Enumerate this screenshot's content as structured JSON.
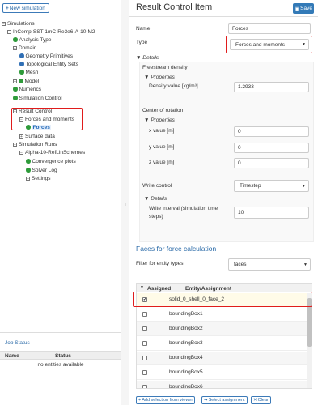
{
  "left": {
    "new_sim_label": "New simulation",
    "tree": [
      {
        "label": "Simulations"
      },
      {
        "label": "InComp-SST-1mC-Re3e6-A-10-M2"
      },
      {
        "label": "Analysis Type"
      },
      {
        "label": "Domain"
      },
      {
        "label": "Geometry Primitives"
      },
      {
        "label": "Topological Entity Sets"
      },
      {
        "label": "Mesh"
      },
      {
        "label": "Model"
      },
      {
        "label": "Numerics"
      },
      {
        "label": "Simulation Control"
      },
      {
        "label": "Result Control"
      },
      {
        "label": "Forces and moments"
      },
      {
        "label": "Forces"
      },
      {
        "label": "Surface data"
      },
      {
        "label": "Simulation Runs"
      },
      {
        "label": "Alpha-10-RefLinSchemes"
      },
      {
        "label": "Convergence plots"
      },
      {
        "label": "Solver Log"
      },
      {
        "label": "Settings"
      }
    ],
    "job": {
      "title": "Job Status",
      "col_name": "Name",
      "col_status": "Status",
      "empty": "no entities available"
    }
  },
  "right": {
    "title": "Result Control Item",
    "save_label": "Save",
    "name_label": "Name",
    "name_value": "Forces",
    "type_label": "Type",
    "type_value": "Forces and moments",
    "details_label": "Details",
    "freestream_label": "Freestream density",
    "properties_label": "Properties",
    "density_label": "Density value [kg/m³]",
    "density_value": "1.2933",
    "center_label": "Center of rotation",
    "properties2_label": "Properties",
    "x_label": "x value [m]",
    "x_value": "0",
    "y_label": "y value [m]",
    "y_value": "0",
    "z_label": "z value [m]",
    "z_value": "0",
    "write_label": "Write control",
    "write_value": "Timestep",
    "details2_label": "Details",
    "interval_label_1": "Write interval (simulation time",
    "interval_label_2": "steps)",
    "interval_value": "10",
    "faces_title": "Faces for force calculation",
    "filter_label": "Filter for entity types",
    "filter_value": "faces",
    "table": {
      "col_assigned": "Assigned",
      "col_entity": "Entity/Assignment",
      "rows": [
        {
          "name": "solid_0_shell_0_face_2",
          "checked": true
        },
        {
          "name": "boundingBox1",
          "checked": false
        },
        {
          "name": "boundingBox2",
          "checked": false
        },
        {
          "name": "boundingBox3",
          "checked": false
        },
        {
          "name": "boundingBox4",
          "checked": false
        },
        {
          "name": "boundingBox5",
          "checked": false
        },
        {
          "name": "boundingBox6",
          "checked": false
        }
      ]
    },
    "buttons": {
      "add": "Add selection from viewer",
      "select": "Select assignment",
      "clear": "Clear"
    }
  },
  "colors": {
    "accent": "#337ab7",
    "highlight": "#e01c1c",
    "ok": "#2e9b3a"
  }
}
